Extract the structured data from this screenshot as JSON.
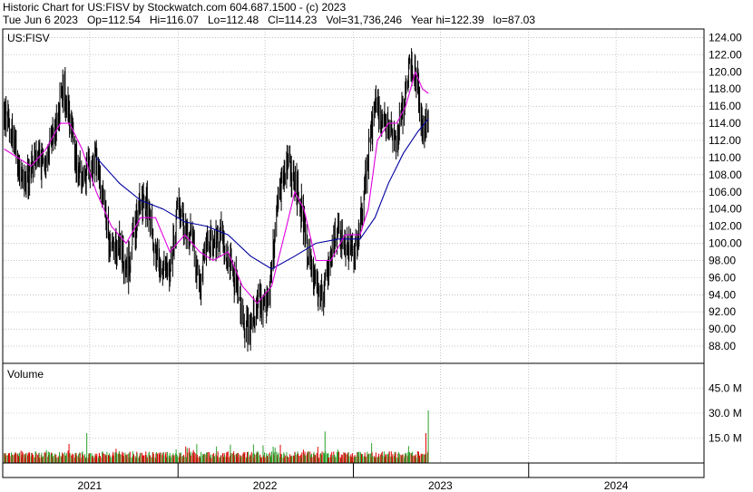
{
  "header": {
    "title": "Historic Chart for US:FISV by Stockwatch.com 604.687.1500 - (c) 2023",
    "quote": {
      "date": "Tue Jun  6 2023",
      "open": "Op=112.54",
      "high": "Hi=116.07",
      "low": "Lo=112.48",
      "close": "Cl=114.23",
      "volume": "Vol=31,736,246",
      "year_high": "Year hi=122.39",
      "year_low": "lo=87.03"
    }
  },
  "colors": {
    "price_bars": "#000000",
    "ma_short": "#e000e0",
    "ma_long": "#0000a0",
    "volume_up": "#2ca02c",
    "volume_down": "#e00000",
    "grid": "#a0a0a0",
    "frame": "#000000"
  },
  "chart_data": [
    {
      "type": "line",
      "symbol": "US:FISV",
      "series_style": "ohlc-bars with two moving averages",
      "yaxis_position": "right",
      "ylim": [
        86,
        125
      ],
      "y_ticks": [
        "124.00",
        "122.00",
        "120.00",
        "118.00",
        "116.00",
        "114.00",
        "112.00",
        "110.00",
        "108.00",
        "106.00",
        "104.00",
        "102.00",
        "100.00",
        "98.00",
        "96.00",
        "94.00",
        "92.00",
        "90.00",
        "88.00"
      ],
      "y_tick_values": [
        124,
        122,
        120,
        118,
        116,
        114,
        112,
        110,
        108,
        106,
        104,
        102,
        100,
        98,
        96,
        94,
        92,
        90,
        88
      ],
      "x_labels": [
        "2021",
        "2022",
        "2023",
        "2024"
      ],
      "x_label_positions": [
        "2021-07",
        "2022-07",
        "2023-07",
        "2024-07"
      ],
      "xlim": [
        "2021-01-01",
        "2024-12-31"
      ],
      "vertical_grid_dates": [
        "2021-01-01",
        "2021-07-01",
        "2022-01-01",
        "2022-07-01",
        "2023-01-01",
        "2023-07-01",
        "2024-01-01",
        "2024-07-01"
      ],
      "grid": true,
      "price_close_points": [
        [
          "2021-01-04",
          115
        ],
        [
          "2021-01-20",
          113
        ],
        [
          "2021-02-05",
          108
        ],
        [
          "2021-02-20",
          107
        ],
        [
          "2021-03-05",
          110
        ],
        [
          "2021-03-20",
          109
        ],
        [
          "2021-04-05",
          111
        ],
        [
          "2021-04-20",
          113
        ],
        [
          "2021-05-05",
          118
        ],
        [
          "2021-05-15",
          117
        ],
        [
          "2021-06-01",
          110
        ],
        [
          "2021-06-15",
          108
        ],
        [
          "2021-07-01",
          109
        ],
        [
          "2021-07-15",
          110
        ],
        [
          "2021-07-30",
          104
        ],
        [
          "2021-08-15",
          99
        ],
        [
          "2021-09-01",
          100
        ],
        [
          "2021-09-15",
          96
        ],
        [
          "2021-10-01",
          101
        ],
        [
          "2021-10-15",
          105
        ],
        [
          "2021-11-01",
          104
        ],
        [
          "2021-11-15",
          99
        ],
        [
          "2021-12-01",
          97
        ],
        [
          "2021-12-15",
          97
        ],
        [
          "2022-01-01",
          104
        ],
        [
          "2022-01-15",
          102
        ],
        [
          "2022-02-01",
          100
        ],
        [
          "2022-02-15",
          95
        ],
        [
          "2022-03-01",
          100
        ],
        [
          "2022-03-15",
          100
        ],
        [
          "2022-04-01",
          101
        ],
        [
          "2022-04-15",
          98
        ],
        [
          "2022-05-01",
          95
        ],
        [
          "2022-05-15",
          91
        ],
        [
          "2022-06-01",
          90
        ],
        [
          "2022-06-15",
          94
        ],
        [
          "2022-07-01",
          92
        ],
        [
          "2022-07-15",
          97
        ],
        [
          "2022-08-01",
          106
        ],
        [
          "2022-08-15",
          109
        ],
        [
          "2022-09-01",
          107
        ],
        [
          "2022-09-15",
          104
        ],
        [
          "2022-10-01",
          98
        ],
        [
          "2022-10-15",
          95
        ],
        [
          "2022-11-01",
          94
        ],
        [
          "2022-11-15",
          99
        ],
        [
          "2022-12-01",
          102
        ],
        [
          "2022-12-15",
          100
        ],
        [
          "2023-01-01",
          99
        ],
        [
          "2023-01-15",
          102
        ],
        [
          "2023-02-01",
          110
        ],
        [
          "2023-02-15",
          116
        ],
        [
          "2023-03-01",
          115
        ],
        [
          "2023-03-15",
          113
        ],
        [
          "2023-04-01",
          112
        ],
        [
          "2023-04-15",
          116
        ],
        [
          "2023-05-01",
          121
        ],
        [
          "2023-05-15",
          119
        ],
        [
          "2023-05-25",
          113
        ],
        [
          "2023-06-06",
          114.23
        ]
      ],
      "ma_short_points": [
        [
          "2021-01-04",
          111
        ],
        [
          "2021-02-01",
          110
        ],
        [
          "2021-03-01",
          109
        ],
        [
          "2021-04-01",
          111
        ],
        [
          "2021-05-01",
          114
        ],
        [
          "2021-05-20",
          114
        ],
        [
          "2021-06-15",
          111
        ],
        [
          "2021-07-15",
          106
        ],
        [
          "2021-08-15",
          102
        ],
        [
          "2021-09-15",
          100
        ],
        [
          "2021-10-15",
          103
        ],
        [
          "2021-11-15",
          103
        ],
        [
          "2021-12-15",
          99
        ],
        [
          "2022-01-15",
          101
        ],
        [
          "2022-02-15",
          99
        ],
        [
          "2022-03-15",
          98
        ],
        [
          "2022-04-15",
          99
        ],
        [
          "2022-05-15",
          95
        ],
        [
          "2022-06-15",
          93
        ],
        [
          "2022-07-15",
          95
        ],
        [
          "2022-08-15",
          102
        ],
        [
          "2022-09-01",
          106
        ],
        [
          "2022-09-20",
          104
        ],
        [
          "2022-10-15",
          98
        ],
        [
          "2022-11-15",
          98
        ],
        [
          "2022-12-15",
          101
        ],
        [
          "2023-01-15",
          101
        ],
        [
          "2023-02-01",
          104
        ],
        [
          "2023-02-20",
          112
        ],
        [
          "2023-03-15",
          114
        ],
        [
          "2023-04-01",
          114
        ],
        [
          "2023-04-20",
          116
        ],
        [
          "2023-05-10",
          120
        ],
        [
          "2023-05-25",
          118
        ],
        [
          "2023-06-06",
          117.5
        ]
      ],
      "ma_long_points": [
        [
          "2021-07-15",
          110
        ],
        [
          "2021-09-01",
          107
        ],
        [
          "2021-10-15",
          105
        ],
        [
          "2021-12-01",
          104
        ],
        [
          "2022-01-15",
          102.5
        ],
        [
          "2022-03-01",
          102
        ],
        [
          "2022-04-15",
          101
        ],
        [
          "2022-06-01",
          98.5
        ],
        [
          "2022-07-15",
          97
        ],
        [
          "2022-09-01",
          98.5
        ],
        [
          "2022-10-15",
          100
        ],
        [
          "2022-12-01",
          100.5
        ],
        [
          "2023-01-15",
          100.5
        ],
        [
          "2023-02-15",
          103
        ],
        [
          "2023-03-15",
          107
        ],
        [
          "2023-04-15",
          110.5
        ],
        [
          "2023-05-15",
          113
        ],
        [
          "2023-06-06",
          114.5
        ]
      ]
    },
    {
      "type": "bar",
      "title": "Volume",
      "yaxis_position": "right",
      "ylim": [
        0,
        60
      ],
      "y_ticks": [
        "45.0 M",
        "30.0 M",
        "15.0 M"
      ],
      "y_tick_values": [
        45,
        30,
        15
      ],
      "unit": "M shares",
      "typical_volume_range": [
        3,
        7
      ],
      "spikes": [
        [
          "2021-06-25",
          18
        ],
        [
          "2021-07-10",
          11
        ],
        [
          "2022-01-20",
          9
        ],
        [
          "2022-08-02",
          11
        ],
        [
          "2022-11-03",
          19
        ],
        [
          "2023-02-08",
          12
        ],
        [
          "2023-06-01",
          18
        ],
        [
          "2023-06-06",
          31.7
        ]
      ]
    }
  ],
  "price_panel_label": "US:FISV",
  "volume_panel_label": "Volume"
}
